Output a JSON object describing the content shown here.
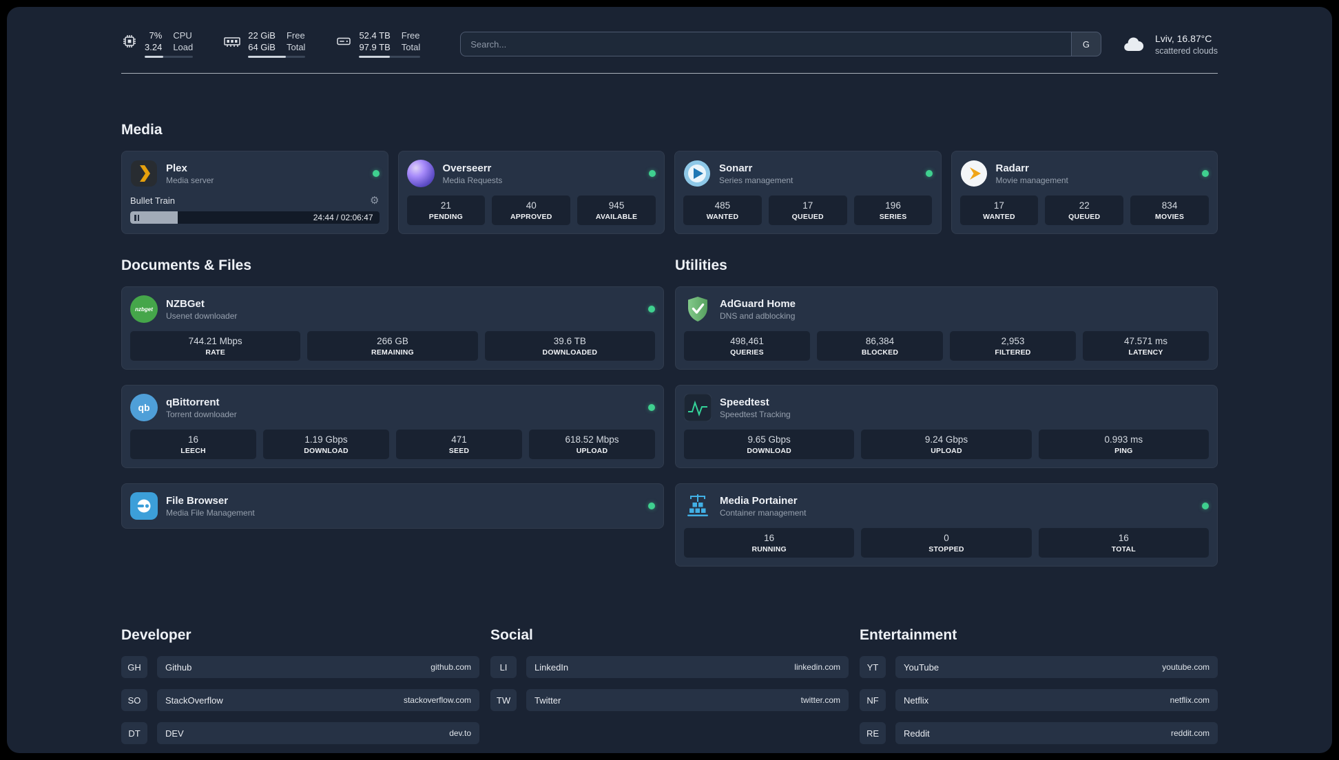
{
  "topbar": {
    "cpu": {
      "value_top": "7%",
      "value_bottom": "3.24",
      "label_top": "CPU",
      "label_bottom": "Load"
    },
    "memory": {
      "value_top": "22 GiB",
      "value_bottom": "64 GiB",
      "label_top": "Free",
      "label_bottom": "Total"
    },
    "disk": {
      "value_top": "52.4 TB",
      "value_bottom": "97.9 TB",
      "label_top": "Free",
      "label_bottom": "Total"
    },
    "search": {
      "placeholder": "Search...",
      "provider_label": "G"
    },
    "weather": {
      "location": "Lviv, 16.87°C",
      "condition": "scattered clouds"
    }
  },
  "media": {
    "title": "Media",
    "plex": {
      "name": "Plex",
      "subtitle": "Media server",
      "now_playing": "Bullet Train",
      "time": "24:44 / 02:06:47"
    },
    "overseerr": {
      "name": "Overseerr",
      "subtitle": "Media Requests",
      "stats": [
        {
          "value": "21",
          "label": "PENDING"
        },
        {
          "value": "40",
          "label": "APPROVED"
        },
        {
          "value": "945",
          "label": "AVAILABLE"
        }
      ]
    },
    "sonarr": {
      "name": "Sonarr",
      "subtitle": "Series management",
      "stats": [
        {
          "value": "485",
          "label": "WANTED"
        },
        {
          "value": "17",
          "label": "QUEUED"
        },
        {
          "value": "196",
          "label": "SERIES"
        }
      ]
    },
    "radarr": {
      "name": "Radarr",
      "subtitle": "Movie management",
      "stats": [
        {
          "value": "17",
          "label": "WANTED"
        },
        {
          "value": "22",
          "label": "QUEUED"
        },
        {
          "value": "834",
          "label": "MOVIES"
        }
      ]
    }
  },
  "documents": {
    "title": "Documents & Files",
    "nzbget": {
      "name": "NZBGet",
      "subtitle": "Usenet downloader",
      "stats": [
        {
          "value": "744.21 Mbps",
          "label": "RATE"
        },
        {
          "value": "266 GB",
          "label": "REMAINING"
        },
        {
          "value": "39.6 TB",
          "label": "DOWNLOADED"
        }
      ]
    },
    "qbittorrent": {
      "name": "qBittorrent",
      "subtitle": "Torrent downloader",
      "stats": [
        {
          "value": "16",
          "label": "LEECH"
        },
        {
          "value": "1.19 Gbps",
          "label": "DOWNLOAD"
        },
        {
          "value": "471",
          "label": "SEED"
        },
        {
          "value": "618.52 Mbps",
          "label": "UPLOAD"
        }
      ]
    },
    "filebrowser": {
      "name": "File Browser",
      "subtitle": "Media File Management"
    }
  },
  "utilities": {
    "title": "Utilities",
    "adguard": {
      "name": "AdGuard Home",
      "subtitle": "DNS and adblocking",
      "stats": [
        {
          "value": "498,461",
          "label": "QUERIES"
        },
        {
          "value": "86,384",
          "label": "BLOCKED"
        },
        {
          "value": "2,953",
          "label": "FILTERED"
        },
        {
          "value": "47.571 ms",
          "label": "LATENCY"
        }
      ]
    },
    "speedtest": {
      "name": "Speedtest",
      "subtitle": "Speedtest Tracking",
      "stats": [
        {
          "value": "9.65 Gbps",
          "label": "DOWNLOAD"
        },
        {
          "value": "9.24 Gbps",
          "label": "UPLOAD"
        },
        {
          "value": "0.993 ms",
          "label": "PING"
        }
      ]
    },
    "portainer": {
      "name": "Media Portainer",
      "subtitle": "Container management",
      "stats": [
        {
          "value": "16",
          "label": "RUNNING"
        },
        {
          "value": "0",
          "label": "STOPPED"
        },
        {
          "value": "16",
          "label": "TOTAL"
        }
      ]
    }
  },
  "bookmarks": {
    "developer": {
      "title": "Developer",
      "items": [
        {
          "abbr": "GH",
          "name": "Github",
          "domain": "github.com"
        },
        {
          "abbr": "SO",
          "name": "StackOverflow",
          "domain": "stackoverflow.com"
        },
        {
          "abbr": "DT",
          "name": "DEV",
          "domain": "dev.to"
        }
      ]
    },
    "social": {
      "title": "Social",
      "items": [
        {
          "abbr": "LI",
          "name": "LinkedIn",
          "domain": "linkedin.com"
        },
        {
          "abbr": "TW",
          "name": "Twitter",
          "domain": "twitter.com"
        }
      ]
    },
    "entertainment": {
      "title": "Entertainment",
      "items": [
        {
          "abbr": "YT",
          "name": "YouTube",
          "domain": "youtube.com"
        },
        {
          "abbr": "NF",
          "name": "Netflix",
          "domain": "netflix.com"
        },
        {
          "abbr": "RE",
          "name": "Reddit",
          "domain": "reddit.com"
        }
      ]
    }
  },
  "colors": {
    "background": "#1a2333",
    "card": "#263245",
    "status_online": "#3fd08f",
    "plex_accent": "#e5a00d",
    "adguard_green": "#68b672",
    "speedtest_line": "#34d399"
  }
}
